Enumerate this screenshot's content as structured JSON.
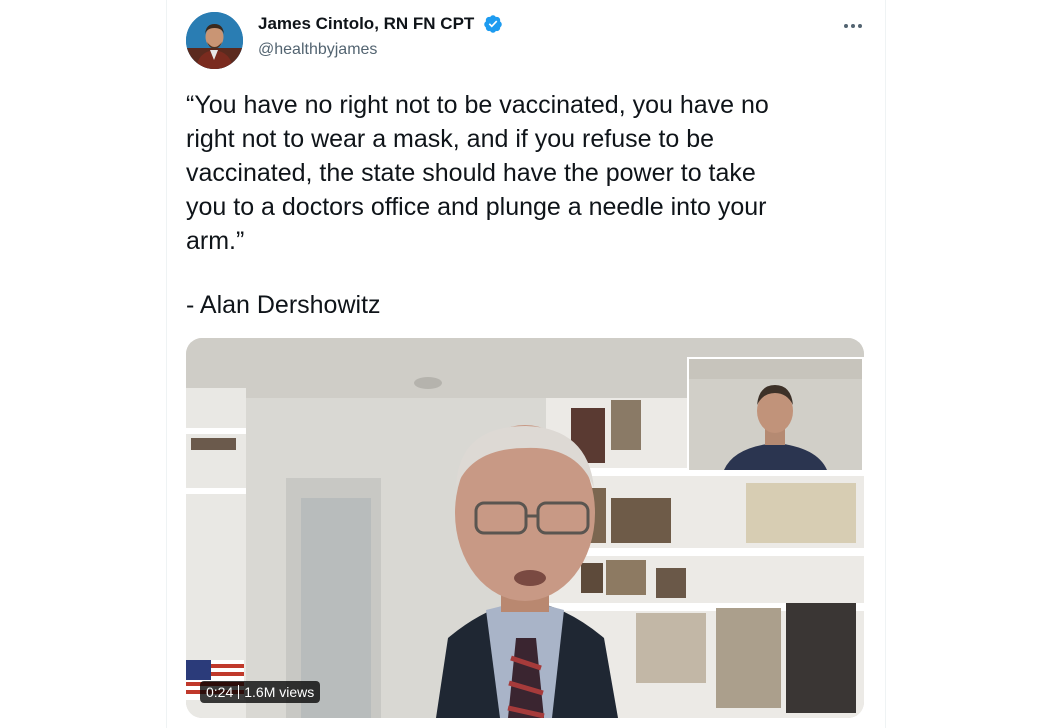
{
  "tweet": {
    "author": {
      "name": "James Cintolo, RN FN CPT",
      "handle": "@healthbyjames",
      "verified": true
    },
    "text": "“You have no right not to be vaccinated, you have no\nright not to wear a mask, and if you refuse to be\nvaccinated, the state should have the power to take\nyou to a doctors office and plunge a needle into your\narm.”",
    "attribution": "- Alan Dershowitz",
    "media": {
      "type": "video",
      "duration": "0:24",
      "views": "1.6M views"
    }
  },
  "colors": {
    "text_primary": "#0f1419",
    "text_secondary": "#536471",
    "verified_blue": "#1d9bf0"
  },
  "icons": [
    "avatar",
    "verified-badge-icon",
    "more-options-icon"
  ]
}
